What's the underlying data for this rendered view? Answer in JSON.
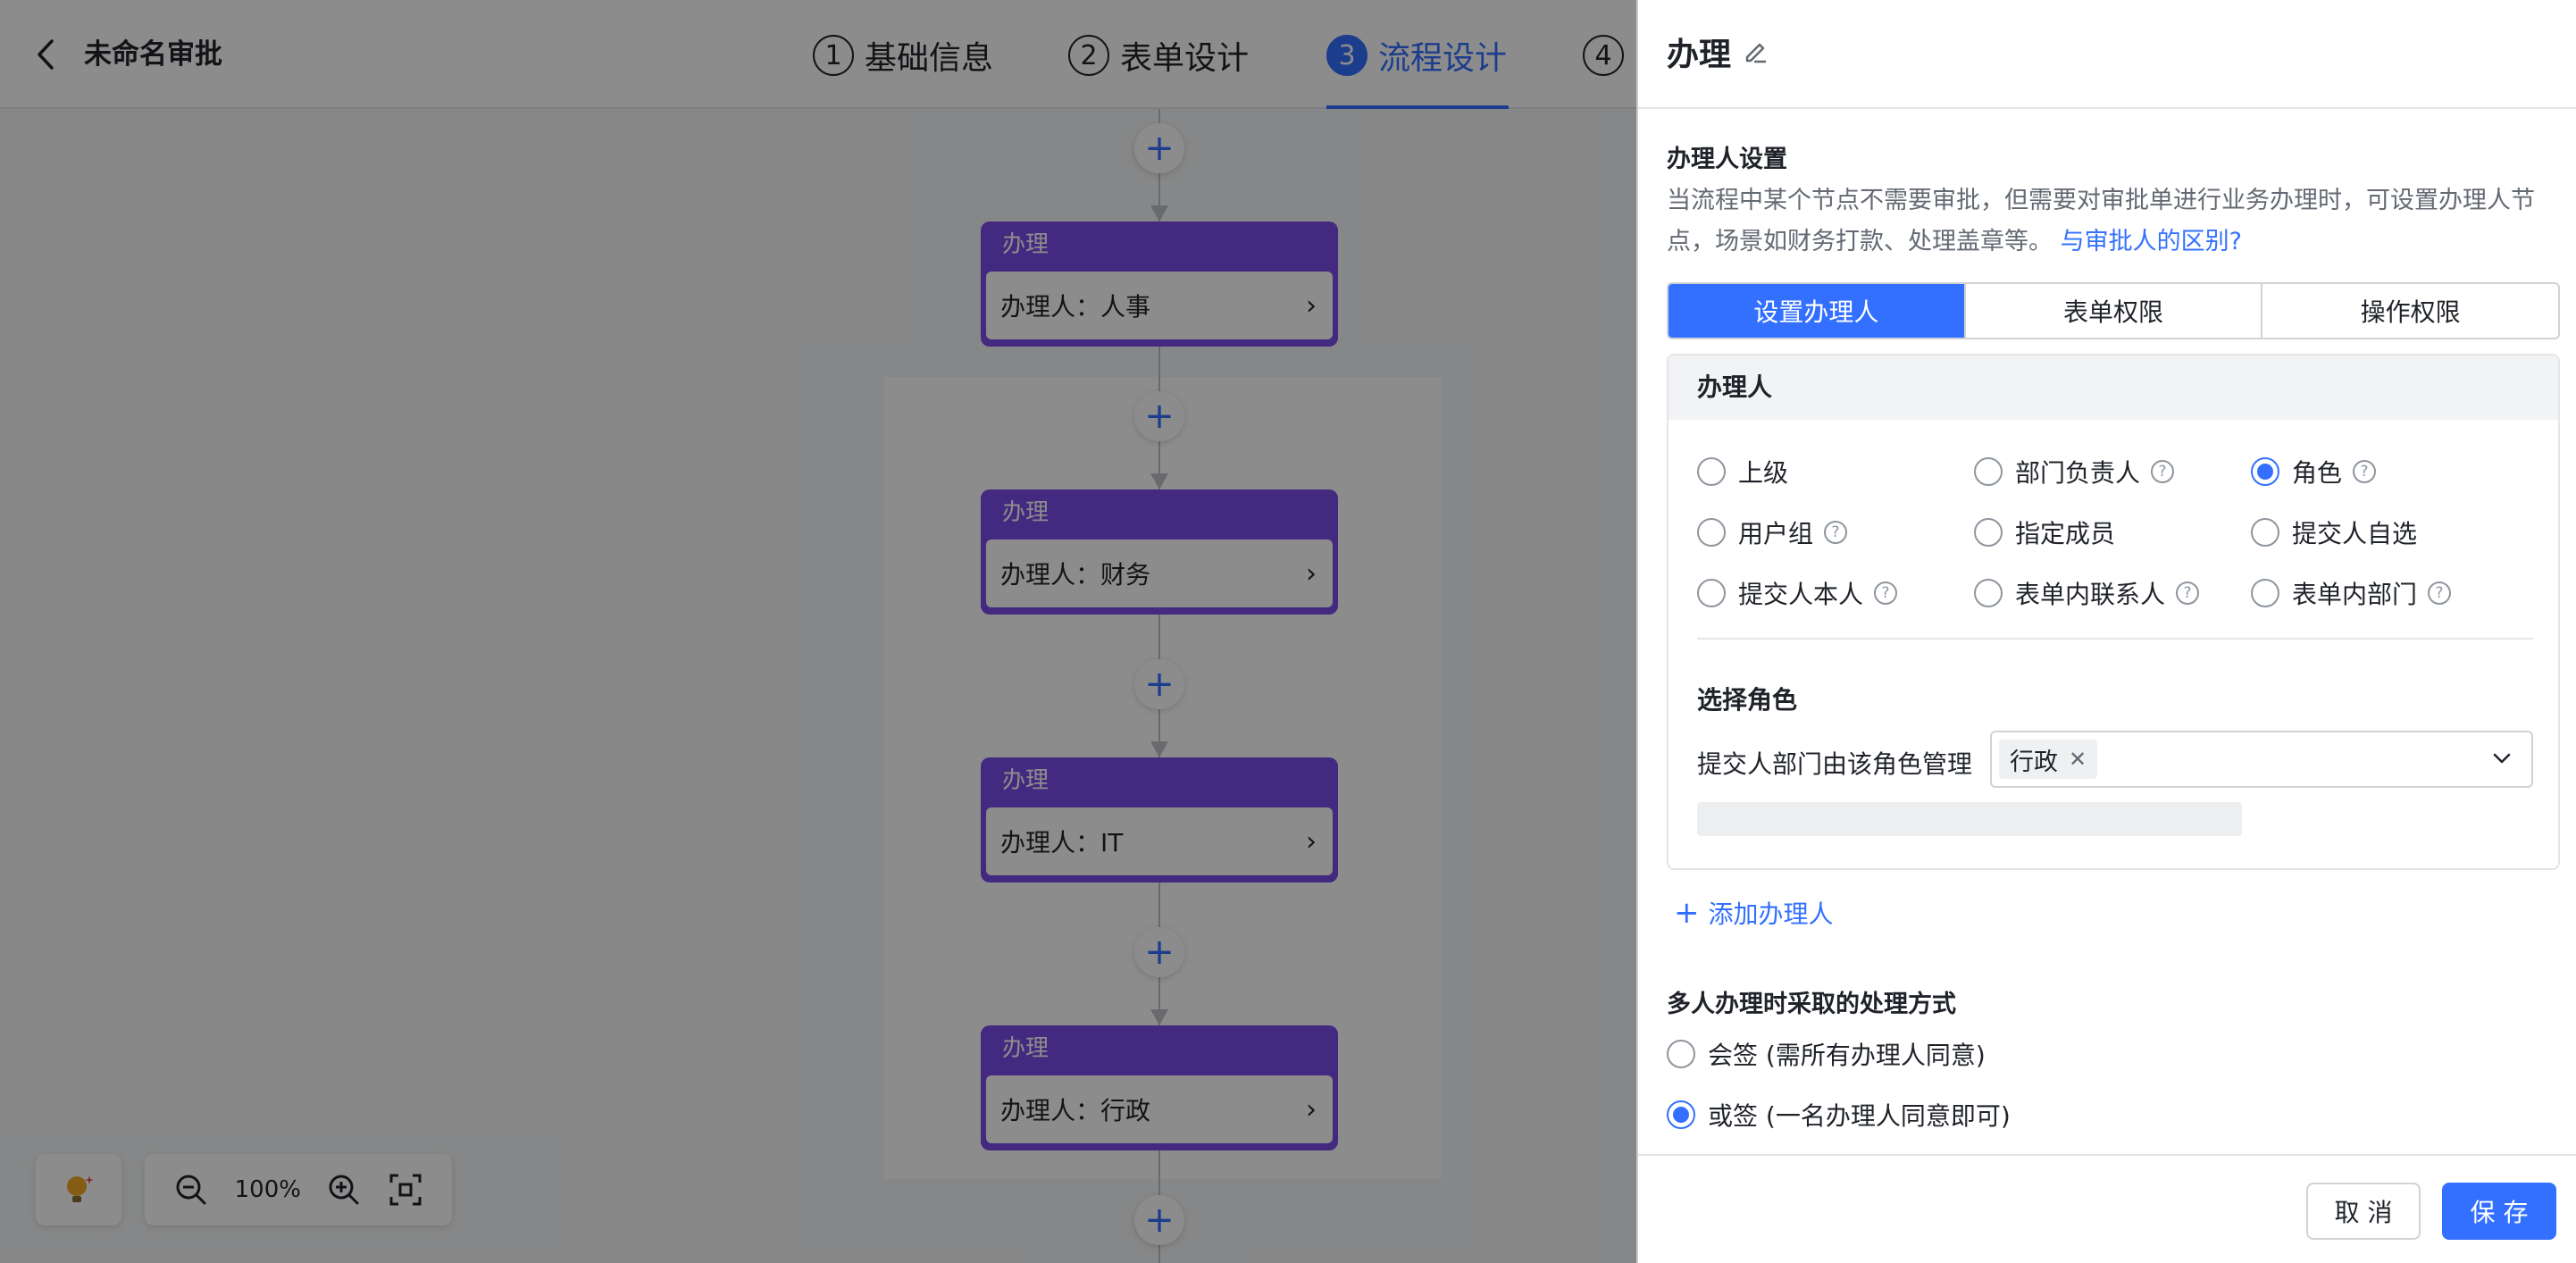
{
  "header": {
    "title": "未命名审批",
    "steps": [
      {
        "num": "1",
        "label": "基础信息"
      },
      {
        "num": "2",
        "label": "表单设计"
      },
      {
        "num": "3",
        "label": "流程设计"
      },
      {
        "num": "4",
        "label": ""
      }
    ],
    "active_step": 3
  },
  "canvas": {
    "add_symbol": "+",
    "nodes": [
      {
        "type": "办理",
        "handler": "办理人：人事"
      },
      {
        "type": "办理",
        "handler": "办理人：财务"
      },
      {
        "type": "办理",
        "handler": "办理人：IT"
      },
      {
        "type": "办理",
        "handler": "办理人：行政"
      }
    ],
    "zoom_level": "100%"
  },
  "drawer": {
    "title": "办理",
    "section_title": "办理人设置",
    "description": "当流程中某个节点不需要审批，但需要对审批单进行业务办理时，可设置办理人节点，场景如财务打款、处理盖章等。",
    "description_link": "与审批人的区别?",
    "tabs": [
      "设置办理人",
      "表单权限",
      "操作权限"
    ],
    "handler_card": {
      "title": "办理人",
      "options": [
        {
          "label": "上级",
          "checked": false,
          "help": false
        },
        {
          "label": "部门负责人",
          "checked": false,
          "help": true
        },
        {
          "label": "角色",
          "checked": true,
          "help": true
        },
        {
          "label": "用户组",
          "checked": false,
          "help": true
        },
        {
          "label": "指定成员",
          "checked": false,
          "help": false
        },
        {
          "label": "提交人自选",
          "checked": false,
          "help": false
        },
        {
          "label": "提交人本人",
          "checked": false,
          "help": true
        },
        {
          "label": "表单内联系人",
          "checked": false,
          "help": true
        },
        {
          "label": "表单内部门",
          "checked": false,
          "help": true
        }
      ],
      "role_title": "选择角色",
      "role_label": "提交人部门由该角色管理",
      "role_tag": "行政"
    },
    "add_handler": "添加办理人",
    "multi_title": "多人办理时采取的处理方式",
    "multi_options": [
      {
        "label": "会签 (需所有办理人同意)",
        "checked": false
      },
      {
        "label": "或签 (一名办理人同意即可)",
        "checked": true
      }
    ],
    "cancel": "取 消",
    "save": "保 存"
  },
  "colors": {
    "accent": "#3370ff",
    "node_purple": "#7b4ce8"
  }
}
